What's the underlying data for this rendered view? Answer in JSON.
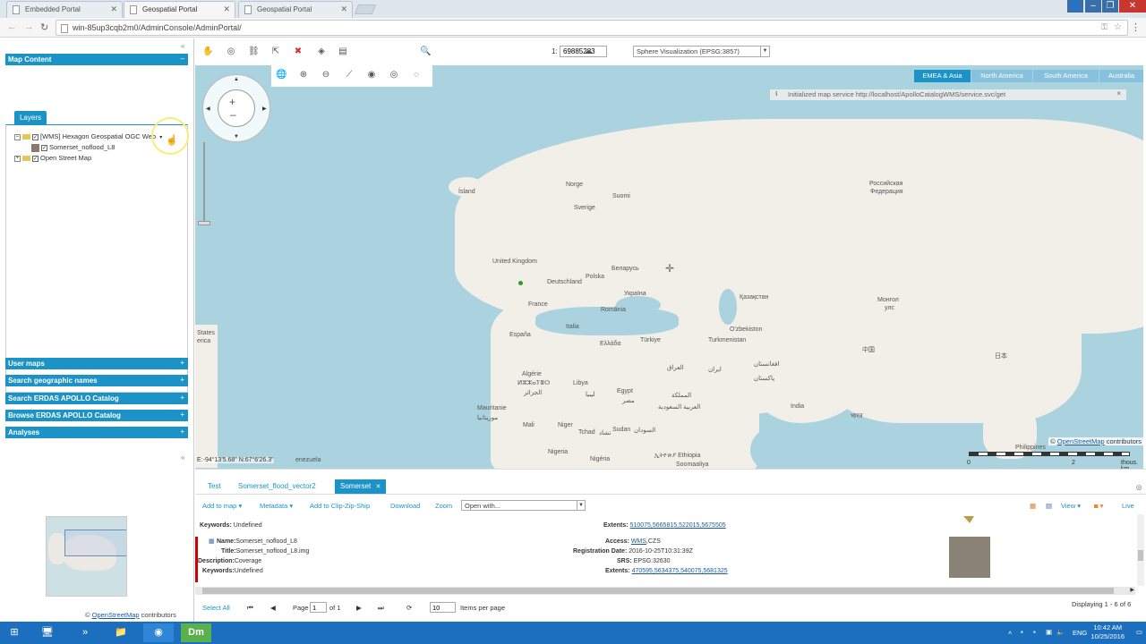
{
  "browser": {
    "tabs": [
      {
        "label": "Embedded Portal"
      },
      {
        "label": "Geospatial Portal"
      },
      {
        "label": "Geospatial Portal"
      }
    ],
    "url": "win-85up3cqb2m0/AdminConsole/AdminPortal/"
  },
  "left_panel": {
    "map_content_title": "Map Content",
    "layers_tab": "Layers",
    "tree": [
      {
        "label": "[WMS] Hexagon Geospatial OGC Web"
      },
      {
        "label": "Somerset_noflood_L8"
      },
      {
        "label": "Open Street Map"
      }
    ],
    "sections": [
      {
        "label": "User maps"
      },
      {
        "label": "Search geographic names"
      },
      {
        "label": "Search ERDAS APOLLO Catalog"
      },
      {
        "label": "Browse ERDAS APOLLO Catalog"
      },
      {
        "label": "Analyses"
      }
    ],
    "overview_credit_prefix": "© ",
    "overview_credit_link": "OpenStreetMap",
    "overview_credit_suffix": " contributors"
  },
  "toolbar": {
    "scale_prefix": "1:",
    "scale_value": "69885283",
    "projection": "Sphere Visualization (EPSG:3857)"
  },
  "map": {
    "region_tabs": [
      {
        "label": "EMEA & Asia",
        "active": true
      },
      {
        "label": "North America"
      },
      {
        "label": "South America"
      },
      {
        "label": "Australia"
      }
    ],
    "info_message": "Initialized map service http://localhost/ApolloCatalogWMS/service.svc/get",
    "coords": "E:-94°13'5.68\"   N:67°6'26.3\"",
    "credit_prefix": "© ",
    "credit_link": "OpenStreetMap",
    "credit_suffix": " contributors",
    "scale_labels": [
      "0",
      "2",
      "thous. km"
    ],
    "place_labels": [
      "Ísland",
      "Norge",
      "Sverige",
      "Suomi",
      "Российская",
      "Федерация",
      "United Kingdom",
      "Deutschland",
      "Polska",
      "Беларусь",
      "Україна",
      "France",
      "România",
      "Қазақстан",
      "Монгол",
      "улс",
      "España",
      "Italia",
      "Ελλάδα",
      "Türkiye",
      "O'zbekiston",
      "Turkmenistan",
      "Algérie",
      "ⵍⵣⵣⴰⵢⴻⵔ",
      "الجزائر",
      "Libya",
      "ليبيا",
      "Egypt",
      "مصر",
      "العراق",
      "ایران",
      "افغانستان",
      "پاکستان",
      "中国",
      "日本",
      "المملكة",
      "العربية السعودية",
      "India",
      "भारत",
      "Mauritanie",
      "موريتانيا",
      "Mali",
      "Niger",
      "Tchad",
      "تشاد",
      "Sudan",
      "السودان",
      "Nigeria",
      "Nigéria",
      "ኢትዮጵያ Ethiopia",
      "Soomaaliya",
      "Philippines",
      "States",
      "erica",
      "enezuela"
    ]
  },
  "bottom_panel": {
    "tabs": [
      {
        "label": "Test"
      },
      {
        "label": "Somerset_flood_vector2"
      },
      {
        "label": "Somerset",
        "active": true
      }
    ],
    "actions": {
      "add_to_map": "Add to map",
      "metadata": "Metadata",
      "add_to_clip": "Add to Clip-Zip-Ship",
      "download": "Download",
      "zoom": "Zoom",
      "open_with": "Open with...",
      "view": "View",
      "live": "Live"
    },
    "row1": {
      "keywords_key": "Keywords:",
      "keywords_val": "Undefined",
      "extents_key": "Extents:",
      "extents_val": "510075,5665815,522015,5675505"
    },
    "row2": {
      "name_key": "Name:",
      "name_val": "Somerset_noflood_L8",
      "title_key": "Title:",
      "title_val": "Somerset_noflood_L8.img",
      "desc_key": "Description:",
      "desc_val": "Coverage",
      "keywords_key": "Keywords:",
      "keywords_val": "Undefined",
      "access_key": "Access:",
      "access_val": "WMS",
      "access_val2": "CZS",
      "regdate_key": "Registration Date:",
      "regdate_val": "2016-10-25T10:31:39Z",
      "srs_key": "SRS:",
      "srs_val": "EPSG:32630",
      "extents_key": "Extents:",
      "extents_val": "470595,5634375,540075,5681325"
    },
    "pager": {
      "select_all": "Select All",
      "page_label": "Page",
      "page_value": "1",
      "of_label": "of 1",
      "per_page_value": "10",
      "per_page_label": "Items per page",
      "displaying": "Displaying 1 - 6 of 6"
    }
  },
  "taskbar": {
    "lang": "ENG",
    "time": "10:42 AM",
    "date": "10/25/2016",
    "dm_label": "Dm"
  }
}
